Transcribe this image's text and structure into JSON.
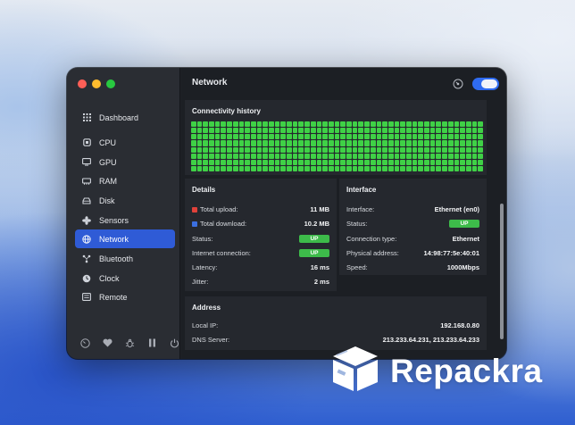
{
  "window": {
    "title": "Network"
  },
  "colors": {
    "accent": "#2f5bd6",
    "up_badge": "#3dbb4a",
    "grid_green": "#3fd146",
    "upload": "#e0413a",
    "download": "#3b6fe0"
  },
  "sidebar": {
    "items": [
      {
        "label": "Dashboard",
        "icon": "grid-icon"
      },
      {
        "label": "CPU",
        "icon": "cpu-icon"
      },
      {
        "label": "GPU",
        "icon": "monitor-icon"
      },
      {
        "label": "RAM",
        "icon": "memory-icon"
      },
      {
        "label": "Disk",
        "icon": "disk-icon"
      },
      {
        "label": "Sensors",
        "icon": "fan-icon"
      },
      {
        "label": "Network",
        "icon": "globe-icon",
        "active": true
      },
      {
        "label": "Bluetooth",
        "icon": "bluetooth-icon"
      },
      {
        "label": "Clock",
        "icon": "clock-icon"
      },
      {
        "label": "Remote",
        "icon": "remote-icon"
      }
    ],
    "footer_icons": [
      "gauge-icon",
      "heart-icon",
      "bug-icon",
      "pause-icon",
      "power-icon"
    ]
  },
  "connectivity": {
    "title": "Connectivity history",
    "columns": 49,
    "rows": 8,
    "status": "all-up"
  },
  "details": {
    "title": "Details",
    "rows": [
      {
        "label": "Total upload:",
        "value": "11 MB"
      },
      {
        "label": "Total download:",
        "value": "10.2 MB"
      },
      {
        "label": "Status:",
        "value": "UP"
      },
      {
        "label": "Internet connection:",
        "value": "UP"
      },
      {
        "label": "Latency:",
        "value": "16 ms"
      },
      {
        "label": "Jitter:",
        "value": "2 ms"
      }
    ]
  },
  "interface": {
    "title": "Interface",
    "rows": [
      {
        "label": "Interface:",
        "value": "Ethernet (en0)"
      },
      {
        "label": "Status:",
        "value": "UP"
      },
      {
        "label": "Connection type:",
        "value": "Ethernet"
      },
      {
        "label": "Physical address:",
        "value": "14:98:77:5e:40:01"
      },
      {
        "label": "Speed:",
        "value": "1000Mbps"
      }
    ]
  },
  "address": {
    "title": "Address",
    "rows": [
      {
        "label": "Local IP:",
        "value": "192.168.0.80"
      },
      {
        "label": "DNS Server:",
        "value": "213.233.64.231, 213.233.64.233"
      }
    ]
  },
  "watermark": {
    "text": "Repackra"
  }
}
